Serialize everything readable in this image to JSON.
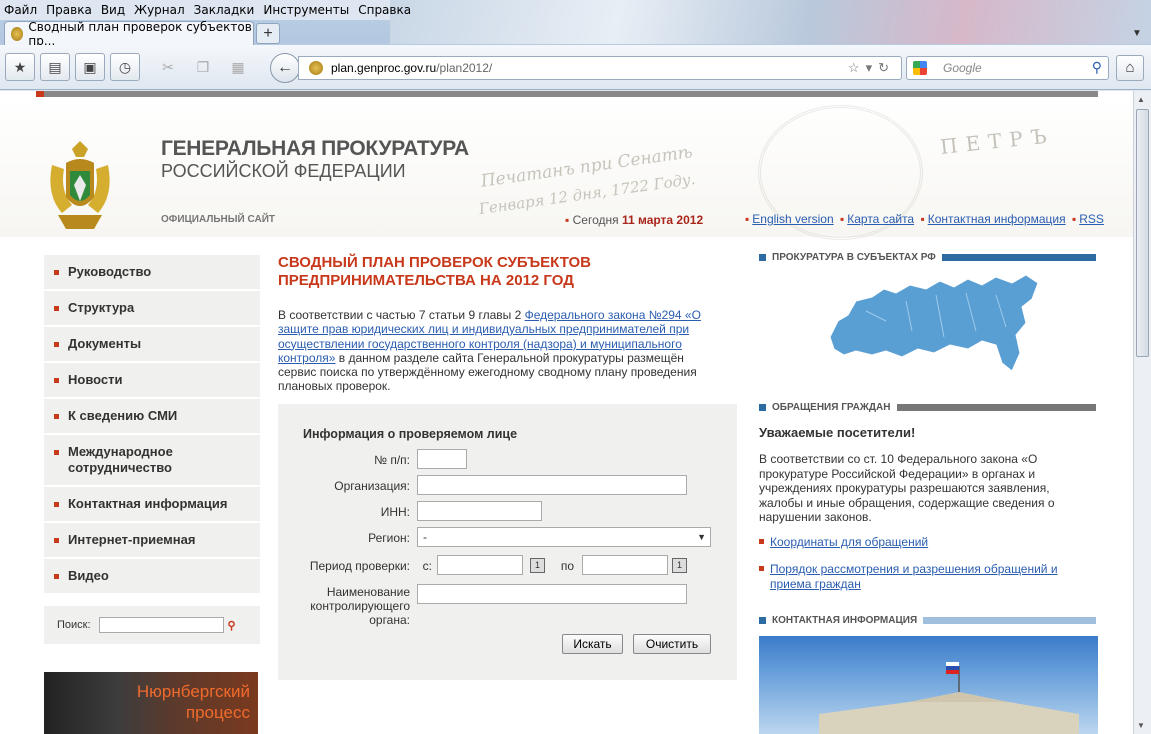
{
  "browser": {
    "menu": [
      "Файл",
      "Правка",
      "Вид",
      "Журнал",
      "Закладки",
      "Инструменты",
      "Справка"
    ],
    "tab_title": "Сводный план проверок субъектов пр...",
    "newtab_label": "+",
    "url_host": "plan.genproc.gov.ru",
    "url_path": "/plan2012/",
    "search_placeholder": "Google",
    "icons": [
      "bookmark-icon",
      "print-icon",
      "new-window-icon",
      "history-icon",
      "cut-icon",
      "copy-icon",
      "paste-icon",
      "back-icon",
      "star-icon",
      "reload-icon",
      "search-icon",
      "home-icon"
    ]
  },
  "header": {
    "title_line1": "ГЕНЕРАЛЬНАЯ ПРОКУРАТУРА",
    "title_line2": "РОССИЙСКОЙ ФЕДЕРАЦИИ",
    "official": "ОФИЦИАЛЬНЫЙ САЙТ",
    "today_label": "Сегодня",
    "today_date": "11 марта 2012",
    "links": [
      "English version",
      "Карта сайта",
      "Контактная информация",
      "RSS"
    ],
    "script_line1": "Печатанъ при Сенатѣ",
    "script_line2": "Генваря 12 дня, 1722 Году.",
    "petr": "ПЕТРЪ"
  },
  "nav": {
    "items": [
      "Руководство",
      "Структура",
      "Документы",
      "Новости",
      "К сведению СМИ",
      "Международное сотрудничество",
      "Контактная информация",
      "Интернет-приемная",
      "Видео"
    ]
  },
  "site_search": {
    "label": "Поиск:"
  },
  "banner": {
    "line1": "Нюрнбергский",
    "line2": "процесс"
  },
  "main": {
    "title": "СВОДНЫЙ ПЛАН ПРОВЕРОК СУБЪЕКТОВ ПРЕДПРИНИМАТЕЛЬСТВА НА 2012 ГОД",
    "intro_before": "В соответствии с частью 7 статьи 9 главы 2 ",
    "intro_link": "Федерального закона №294 «О защите прав юридических лиц и индивидуальных предпринимателей при осуществлении государственного контроля (надзора) и муниципального контроля»",
    "intro_after": " в данном разделе сайта Генеральной прокуратуры размещён сервис поиска по утверждённому ежегодному сводному плану проведения плановых проверок."
  },
  "form": {
    "title": "Информация о проверяемом лице",
    "num_label": "№ п/п:",
    "org_label": "Организация:",
    "inn_label": "ИНН:",
    "region_label": "Регион:",
    "region_value": "-",
    "period_label": "Период проверки:",
    "from_label": "с:",
    "to_label": "по",
    "cal_label": "1",
    "authority_label": "Наименование контролирующего органа:",
    "search_button": "Искать",
    "clear_button": "Очистить"
  },
  "right": {
    "head1": "ПРОКУРАТУРА В СУБЪЕКТАХ РФ",
    "head2": "ОБРАЩЕНИЯ ГРАЖДАН",
    "head3": "КОНТАКТНАЯ ИНФОРМАЦИЯ",
    "greeting": "Уважаемые посетители!",
    "text": "В соответствии со ст. 10 Федерального закона «О прокуратуре Российской Федерации» в органах и учреждениях прокуратуры разрешаются заявления, жалобы и иные обращения, содержащие сведения о нарушении законов.",
    "link1": "Координаты для обращений",
    "link2": "Порядок рассмотрения и разрешения обращений и приема граждан"
  },
  "colors": {
    "accent_red": "#c8381b",
    "nav_bg": "#f0f0ee",
    "map_blue": "#5a9fd4",
    "link": "#2a5db0"
  }
}
